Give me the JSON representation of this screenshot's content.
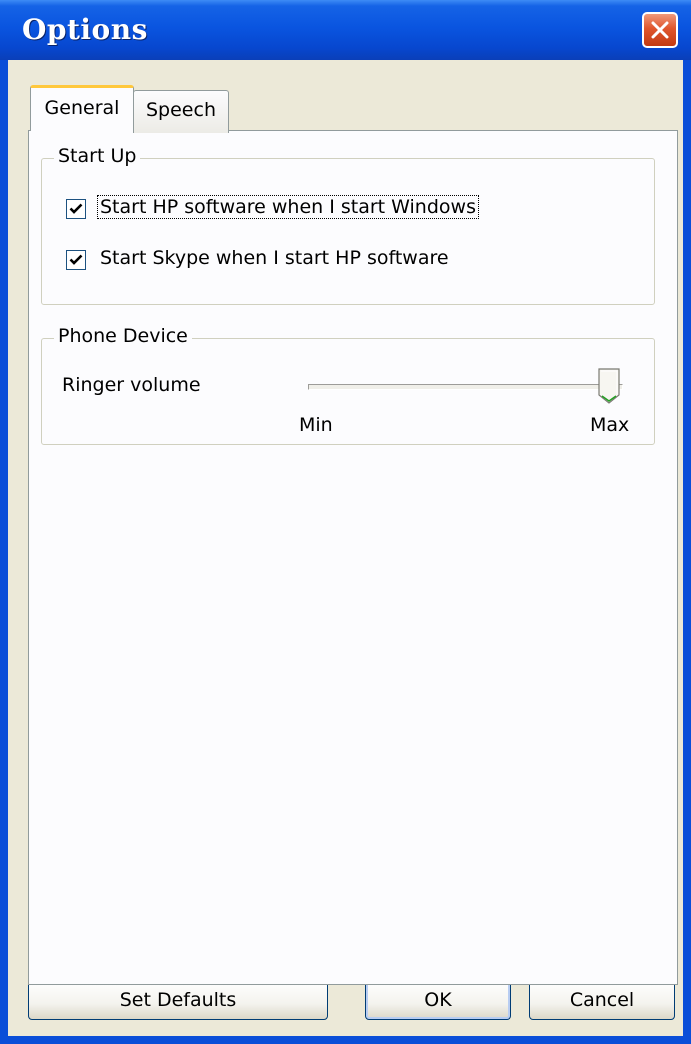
{
  "window": {
    "title": "Options"
  },
  "tabs": [
    {
      "label": "General",
      "active": true
    },
    {
      "label": "Speech",
      "active": false
    }
  ],
  "startup": {
    "label": "Start Up",
    "options": [
      {
        "label": "Start HP software when I start Windows",
        "checked": true,
        "focused": true
      },
      {
        "label": "Start Skype when I start HP software",
        "checked": true,
        "focused": false
      }
    ]
  },
  "phone": {
    "label": "Phone Device",
    "ringer_label": "Ringer volume",
    "slider_min_label": "Min",
    "slider_max_label": "Max",
    "slider_value_fraction": 1.0
  },
  "buttons": {
    "set_defaults": "Set Defaults",
    "ok": "OK",
    "cancel": "Cancel"
  },
  "colors": {
    "titlebar": "#0a55e0",
    "face": "#ece9d8",
    "close": "#e0562d",
    "check": "#21a121"
  },
  "icons": {
    "close": "close-x-icon",
    "check": "checkmark-icon",
    "slider": "slider-thumb-icon"
  }
}
